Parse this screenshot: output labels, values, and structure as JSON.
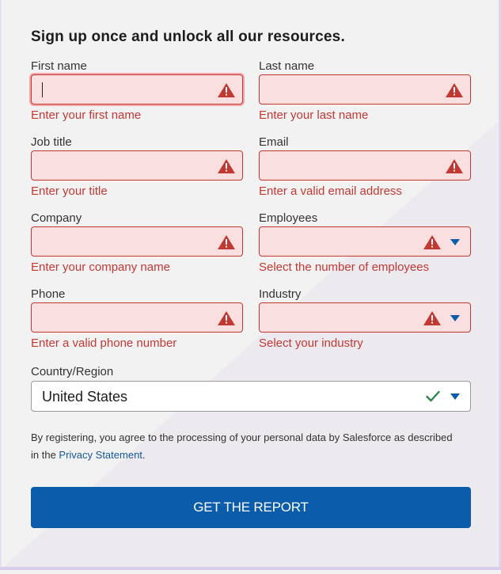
{
  "form": {
    "title": "Sign up once and unlock all our resources.",
    "fields": {
      "first_name": {
        "label": "First name",
        "value": "",
        "error": "Enter your first name"
      },
      "last_name": {
        "label": "Last name",
        "value": "",
        "error": "Enter your last name"
      },
      "job_title": {
        "label": "Job title",
        "value": "",
        "error": "Enter your title"
      },
      "email": {
        "label": "Email",
        "value": "",
        "error": "Enter a valid email address"
      },
      "company": {
        "label": "Company",
        "value": "",
        "error": "Enter your company name"
      },
      "employees": {
        "label": "Employees",
        "value": "",
        "error": "Select the number of employees"
      },
      "phone": {
        "label": "Phone",
        "value": "",
        "error": "Enter a valid phone number"
      },
      "industry": {
        "label": "Industry",
        "value": "",
        "error": "Select your industry"
      },
      "country": {
        "label": "Country/Region",
        "value": "United States"
      }
    },
    "consent": {
      "text_before": "By registering, you agree to the processing of your personal data by Salesforce as described in the ",
      "link_text": "Privacy Statement",
      "text_after": "."
    },
    "submit_label": "GET THE REPORT"
  },
  "icons": {
    "error": "warning-triangle-icon",
    "dropdown": "chevron-down-icon",
    "valid": "checkmark-icon"
  },
  "colors": {
    "error": "#c23934",
    "error_bg": "#f9dfdf",
    "primary_button": "#0b5cab",
    "link": "#16589c",
    "valid": "#2e844a",
    "chevron": "#0b5cab"
  }
}
